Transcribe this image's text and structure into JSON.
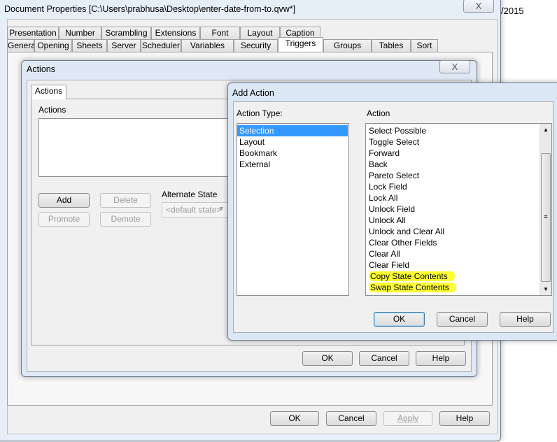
{
  "main": {
    "title": "Document Properties [C:\\Users\\prabhusa\\Desktop\\enter-date-from-to.qvw*]",
    "close": "X",
    "background_text": "/2015",
    "tabs_row1": [
      "Presentation",
      "Number",
      "Scrambling",
      "Extensions",
      "Font",
      "Layout",
      "Caption"
    ],
    "tabs_row2": [
      "General",
      "Opening",
      "Sheets",
      "Server",
      "Scheduler",
      "Variables",
      "Security",
      "Triggers",
      "Groups",
      "Tables",
      "Sort"
    ],
    "selected_tab": "Triggers",
    "buttons": {
      "ok": "OK",
      "cancel": "Cancel",
      "apply": "Apply",
      "help": "Help"
    }
  },
  "actions": {
    "title": "Actions",
    "close": "X",
    "tab": "Actions",
    "list_label": "Actions",
    "add": "Add",
    "delete": "Delete",
    "promote": "Promote",
    "demote": "Demote",
    "alternate_state_label": "Alternate State",
    "alternate_state_value": "<default state>",
    "ok": "OK",
    "cancel": "Cancel",
    "help": "Help"
  },
  "add_action": {
    "title": "Add Action",
    "action_type_label": "Action Type:",
    "action_label": "Action",
    "action_types": [
      "Selection",
      "Layout",
      "Bookmark",
      "External"
    ],
    "selected_type": "Selection",
    "actions": [
      "Select Possible",
      "Toggle Select",
      "Forward",
      "Back",
      "Pareto Select",
      "Lock Field",
      "Lock All",
      "Unlock Field",
      "Unlock All",
      "Unlock and Clear All",
      "Clear Other Fields",
      "Clear All",
      "Clear Field",
      "Copy State Contents",
      "Swap State Contents"
    ],
    "highlighted": [
      "Copy State Contents",
      "Swap State Contents"
    ],
    "highlight_color": "#ffff33",
    "ok": "OK",
    "cancel": "Cancel",
    "help": "Help"
  }
}
